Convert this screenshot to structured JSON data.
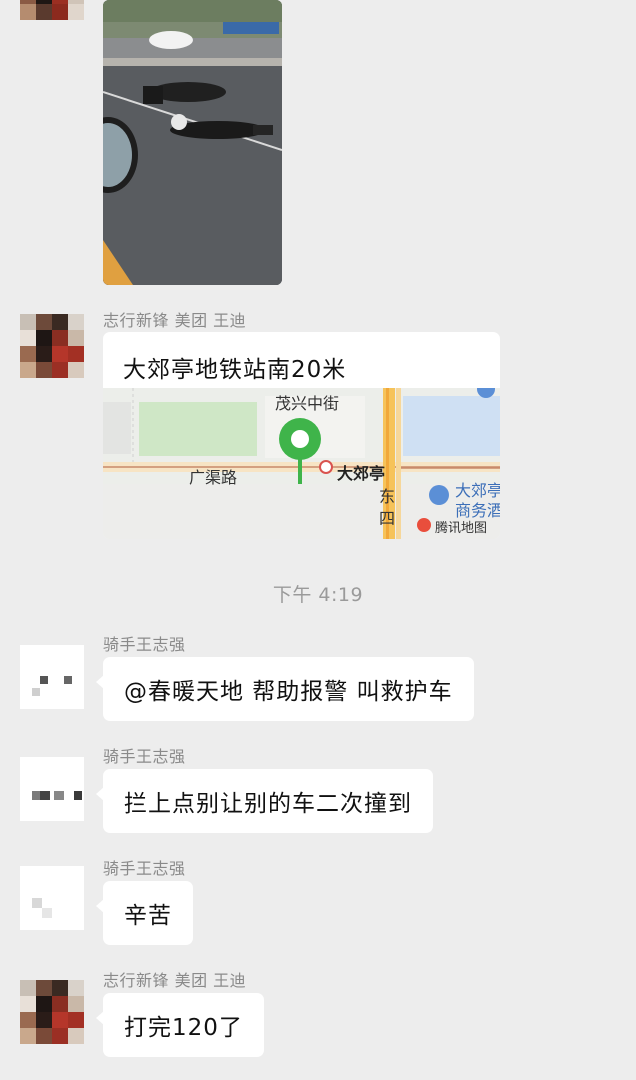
{
  "messages": {
    "location": {
      "sender": "志行新锋 美团 王迪",
      "title": "大郊亭地铁站南20米",
      "map": {
        "street_1": "茂兴中街",
        "street_2": "广渠路",
        "station": "大郊亭",
        "street_3_line1": "东",
        "street_3_line2": "四",
        "poi_line1": "大郊亭",
        "poi_line2": "商务酒",
        "provider": "腾讯地图"
      }
    },
    "timestamp": "下午 4:19",
    "msg1": {
      "sender": "骑手王志强",
      "text": "@春暖天地 帮助报警 叫救护车"
    },
    "msg2": {
      "sender": "骑手王志强",
      "text": "拦上点别让别的车二次撞到"
    },
    "msg3": {
      "sender": "骑手王志强",
      "text": "辛苦"
    },
    "msg4": {
      "sender": "志行新锋 美团 王迪",
      "text": "打完120了"
    }
  },
  "colors": {
    "background": "#ededed",
    "bubble": "#ffffff",
    "map_pin": "#3fb44a",
    "map_road": "#f0c14b"
  }
}
